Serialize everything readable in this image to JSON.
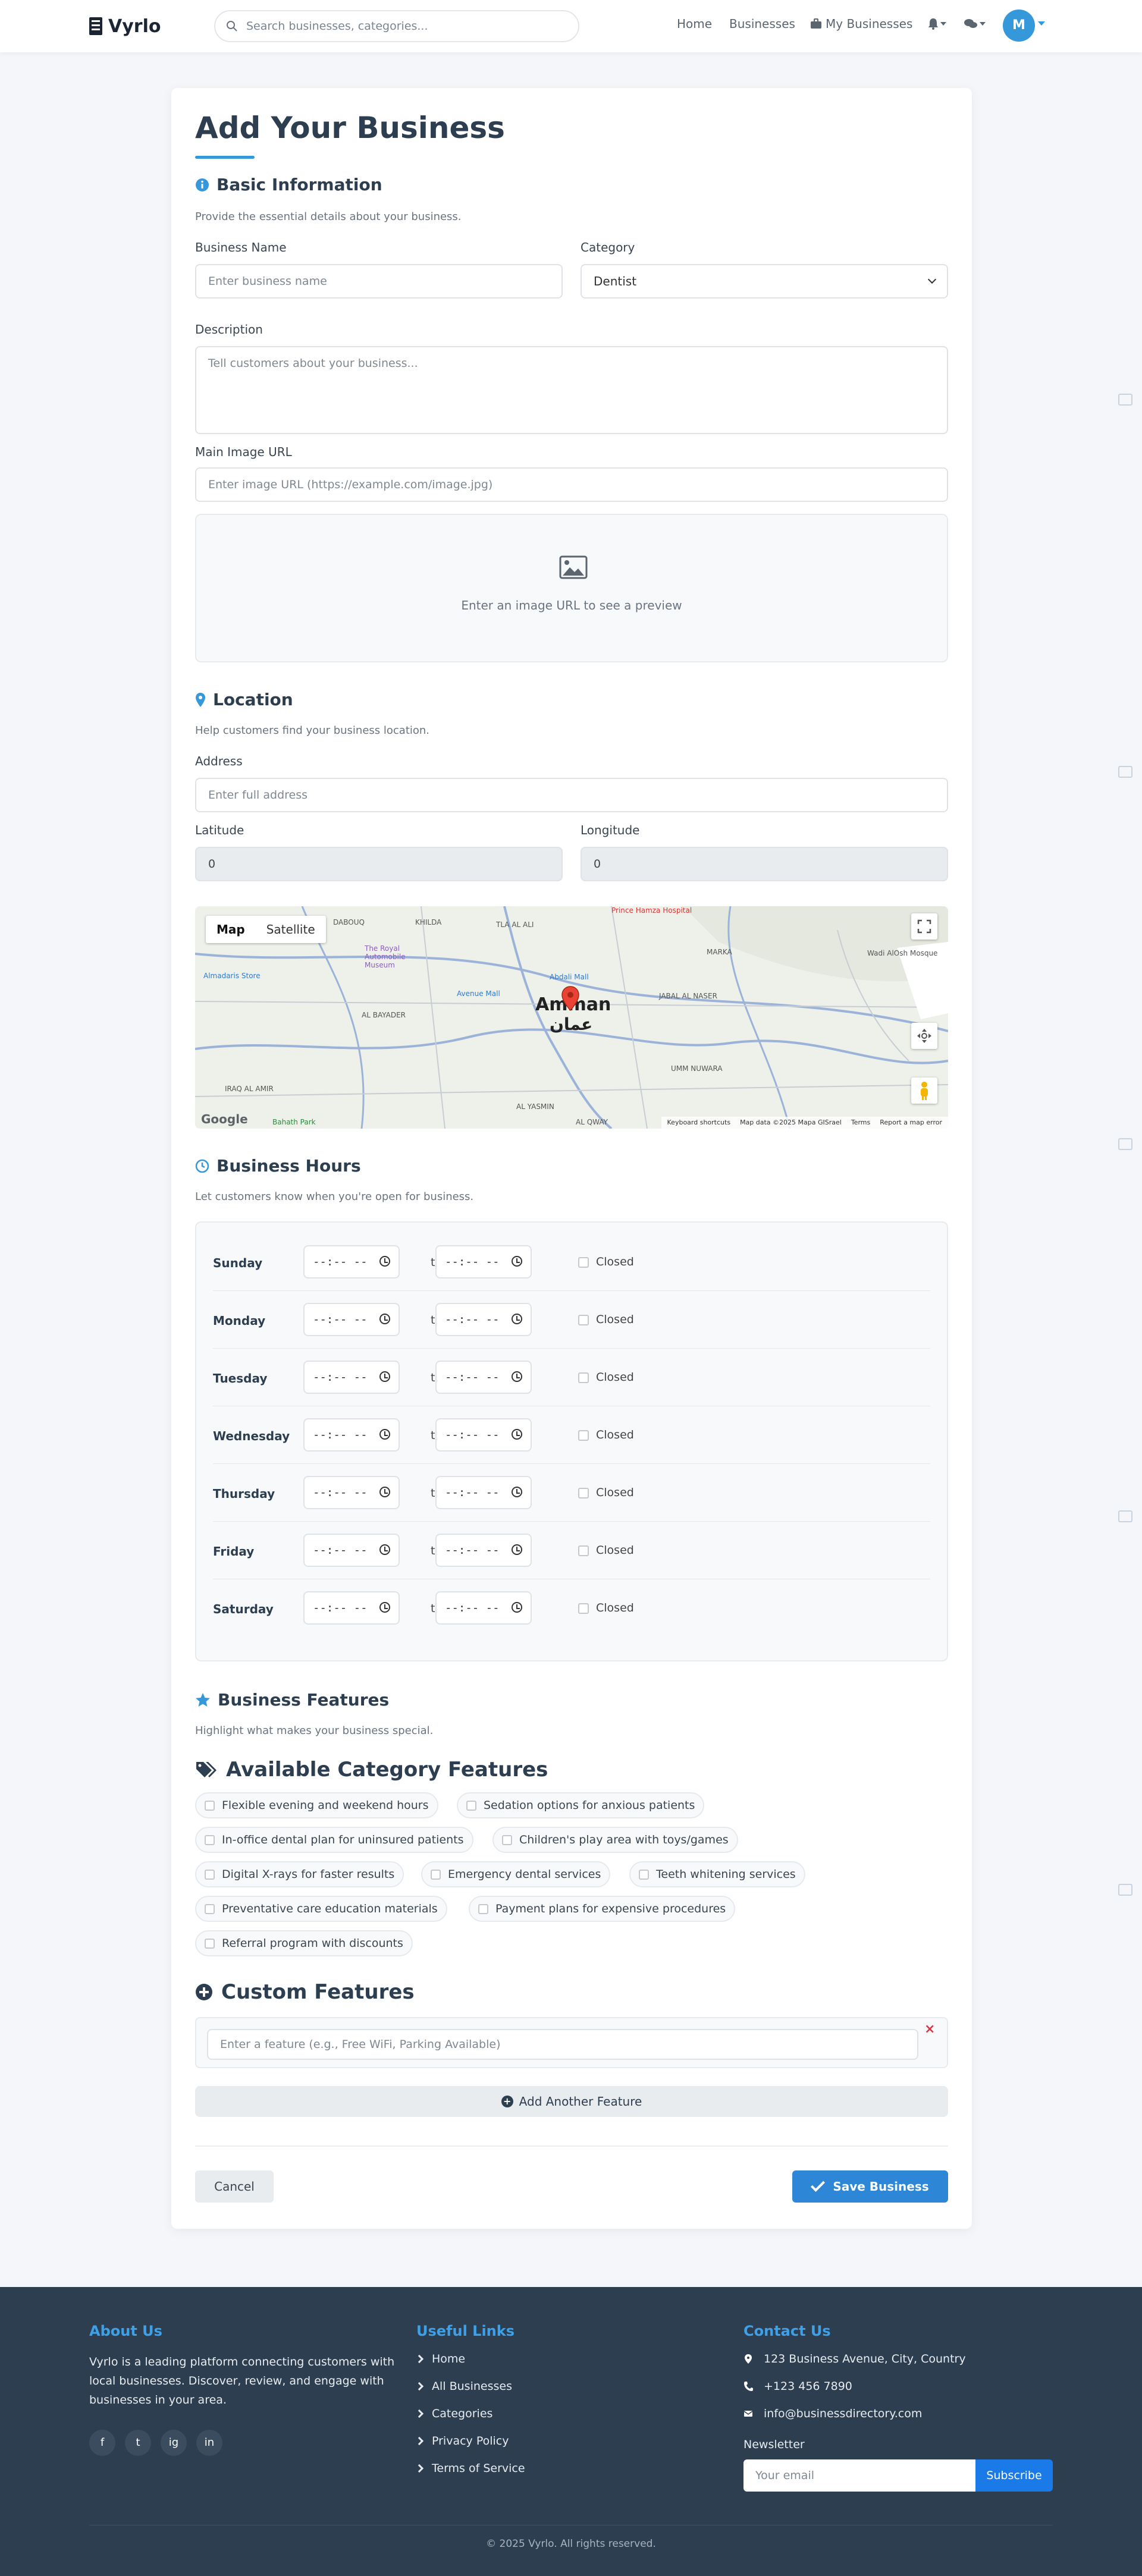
{
  "nav": {
    "brand": "Vyrlo",
    "search_placeholder": "Search businesses, categories...",
    "links": [
      "Home",
      "Businesses",
      "My Businesses"
    ],
    "avatar_initial": "M"
  },
  "form": {
    "title": "Add Your Business",
    "basic": {
      "title": "Basic Information",
      "desc": "Provide the essential details about your business.",
      "name_label": "Business Name",
      "name_placeholder": "Enter business name",
      "category_label": "Category",
      "category_value": "Dentist",
      "desc_label": "Description",
      "desc_placeholder": "Tell customers about your business...",
      "image_label": "Main Image URL",
      "image_placeholder": "Enter image URL (https://example.com/image.jpg)",
      "preview_text": "Enter an image URL to see a preview"
    },
    "location": {
      "title": "Location",
      "desc": "Help customers find your business location.",
      "address_label": "Address",
      "address_placeholder": "Enter full address",
      "lat_label": "Latitude",
      "lat_value": "0",
      "lng_label": "Longitude",
      "lng_value": "0",
      "map": {
        "tab_map": "Map",
        "tab_satellite": "Satellite",
        "city_en": "Amman",
        "city_ar": "عمان",
        "labels": [
          "Prince Hamza Hospital",
          "The Royal Automobile Museum",
          "Almadaris Store",
          "Abdali Mall",
          "Avenue Mall",
          "MARKA",
          "TLA AL ALI",
          "KHILDA",
          "DABOUQ",
          "AL BAYADER",
          "JABAL AL NASER",
          "UMM NUWARA",
          "AL YASMIN",
          "AL QWAY",
          "IRAQ AL AMIR",
          "Bahath Park",
          "Wadi AlOsh Mosque"
        ],
        "google": "Google",
        "footer": [
          "Keyboard shortcuts",
          "Map data ©2025 Mapa GISrael",
          "Terms",
          "Report a map error"
        ]
      }
    },
    "hours": {
      "title": "Business Hours",
      "desc": "Let customers know when you're open for business.",
      "time_placeholder": "--:-- --",
      "to": "to",
      "closed": "Closed",
      "days": [
        "Sunday",
        "Monday",
        "Tuesday",
        "Wednesday",
        "Thursday",
        "Friday",
        "Saturday"
      ]
    },
    "features": {
      "title": "Business Features",
      "desc": "Highlight what makes your business special.",
      "available_title": "Available Category Features",
      "items": [
        "Flexible evening and weekend hours",
        "Sedation options for anxious patients",
        "In-office dental plan for uninsured patients",
        "Children's play area with toys/games",
        "Digital X-rays for faster results",
        "Emergency dental services",
        "Teeth whitening services",
        "Preventative care education materials",
        "Payment plans for expensive procedures",
        "Referral program with discounts"
      ],
      "custom_title": "Custom Features",
      "custom_placeholder": "Enter a feature (e.g., Free WiFi, Parking Available)",
      "add_label": "Add Another Feature"
    },
    "cancel_label": "Cancel",
    "save_label": "Save Business"
  },
  "footer": {
    "about_title": "About Us",
    "about_text": "Vyrlo is a leading platform connecting customers with local businesses. Discover, review, and engage with businesses in your area.",
    "social": [
      "f",
      "t",
      "ig",
      "in"
    ],
    "links_title": "Useful Links",
    "links": [
      "Home",
      "All Businesses",
      "Categories",
      "Privacy Policy",
      "Terms of Service"
    ],
    "contact_title": "Contact Us",
    "address": "123 Business Avenue, City, Country",
    "phone": "+123 456 7890",
    "email": "info@businessdirectory.com",
    "newsletter_label": "Newsletter",
    "newsletter_placeholder": "Your email",
    "subscribe": "Subscribe",
    "copyright": "© 2025 Vyrlo. All rights reserved."
  },
  "colors": {
    "accent": "#3498db",
    "primary_button": "#2e86d6",
    "footer_bg": "#2c3e50",
    "danger": "#dc3545"
  }
}
